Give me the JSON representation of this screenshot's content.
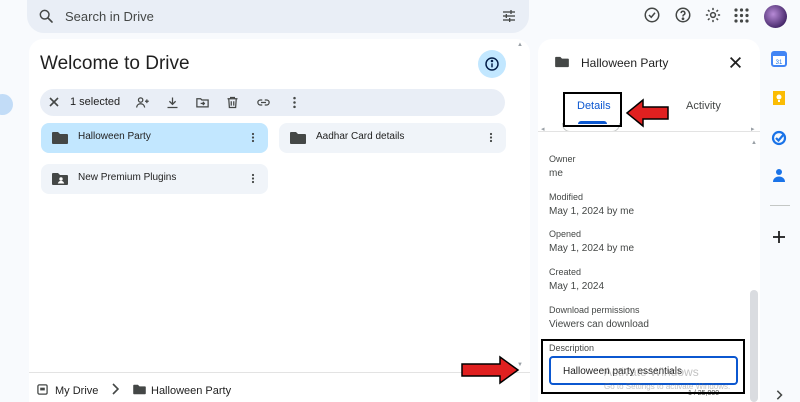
{
  "search": {
    "placeholder": "Search in Drive"
  },
  "topbar": {
    "icons": [
      "offline-status-icon",
      "help-icon",
      "settings-icon",
      "apps-grid-icon",
      "account-avatar"
    ]
  },
  "main": {
    "title": "Welcome to Drive",
    "selection": {
      "count_label": "1 selected",
      "actions": [
        "share",
        "download",
        "move",
        "delete",
        "copy-link",
        "more"
      ]
    },
    "items": [
      {
        "name": "Halloween Party",
        "selected": true,
        "icon": "folder-icon"
      },
      {
        "name": "Aadhar Card details",
        "selected": false,
        "icon": "folder-icon"
      },
      {
        "name": "New Premium Plugins",
        "selected": false,
        "icon": "shared-folder-icon"
      }
    ]
  },
  "breadcrumb": {
    "root": "My Drive",
    "current": "Halloween Party"
  },
  "details": {
    "title": "Halloween Party",
    "tabs": {
      "details": "Details",
      "activity": "Activity"
    },
    "fields": [
      {
        "label": "Owner",
        "value": "me"
      },
      {
        "label": "Modified",
        "value": "May 1, 2024 by me"
      },
      {
        "label": "Opened",
        "value": "May 1, 2024 by me"
      },
      {
        "label": "Created",
        "value": "May 1, 2024"
      },
      {
        "label": "Download permissions",
        "value": "Viewers can download"
      }
    ],
    "description": {
      "label": "Description",
      "value": "Halloween party essentials",
      "counter": "1 / 25,000"
    }
  },
  "watermark": {
    "line1": "Activate Windows",
    "line2": "Go to Settings to activate Windows."
  },
  "colors": {
    "accent": "#0b57d0",
    "selected_bg": "#c2e7ff",
    "annotation_arrow": "#e02020"
  }
}
